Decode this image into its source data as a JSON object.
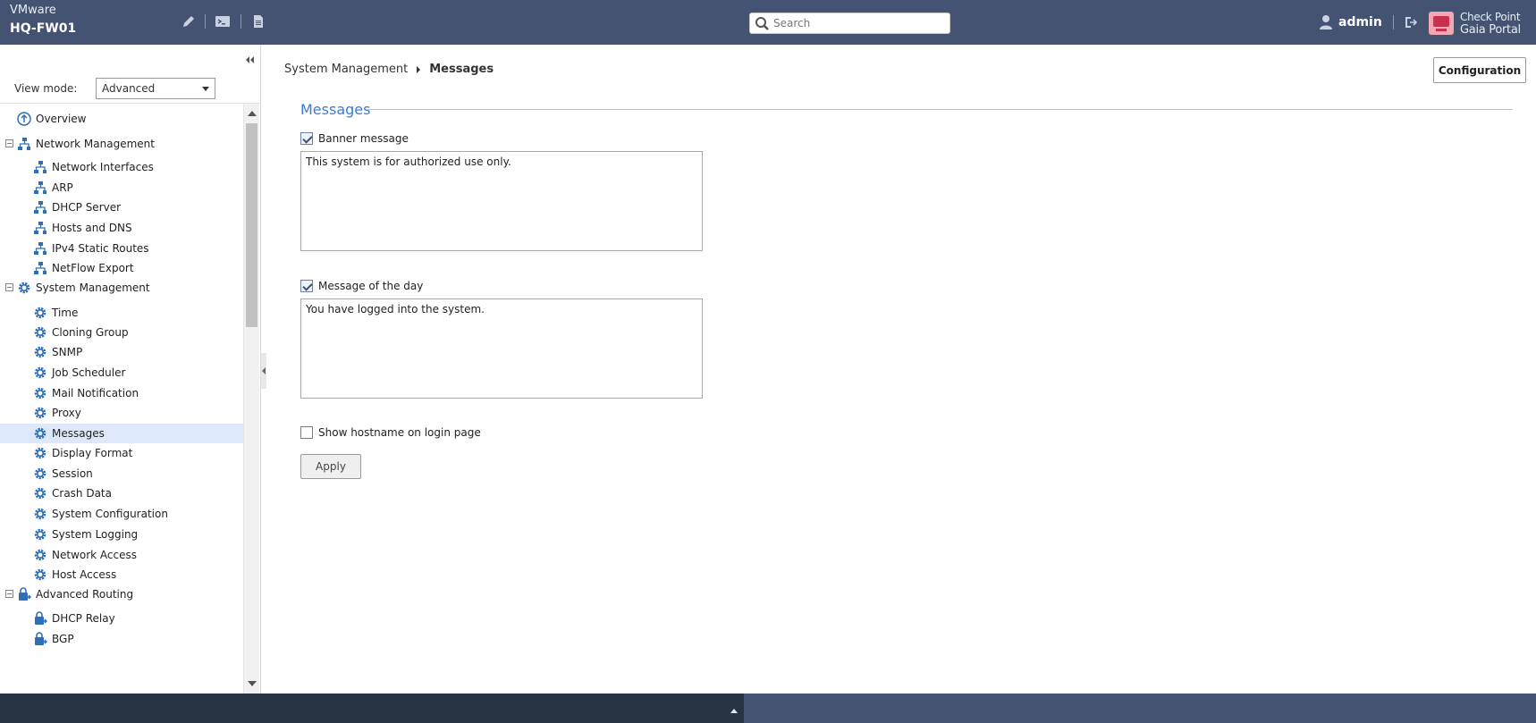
{
  "header": {
    "vendor": "VMware",
    "hostname": "HQ-FW01",
    "search_placeholder": "Search",
    "username": "admin",
    "brand_line1": "Check Point",
    "brand_line2": "Gaia Portal"
  },
  "sidebar": {
    "view_mode_label": "View mode:",
    "view_mode_value": "Advanced",
    "items": [
      {
        "label": "Overview",
        "icon": "overview-icon",
        "level": 0
      },
      {
        "label": "Network Management",
        "icon": "network-icon",
        "level": 0,
        "expanded": true
      },
      {
        "label": "Network Interfaces",
        "icon": "network-icon",
        "level": 1
      },
      {
        "label": "ARP",
        "icon": "network-icon",
        "level": 1
      },
      {
        "label": "DHCP Server",
        "icon": "network-icon",
        "level": 1
      },
      {
        "label": "Hosts and DNS",
        "icon": "network-icon",
        "level": 1
      },
      {
        "label": "IPv4 Static Routes",
        "icon": "network-icon",
        "level": 1
      },
      {
        "label": "NetFlow Export",
        "icon": "network-icon",
        "level": 1
      },
      {
        "label": "System Management",
        "icon": "gear-icon",
        "level": 0,
        "expanded": true
      },
      {
        "label": "Time",
        "icon": "gear-icon",
        "level": 1
      },
      {
        "label": "Cloning Group",
        "icon": "gear-icon",
        "level": 1
      },
      {
        "label": "SNMP",
        "icon": "gear-icon",
        "level": 1
      },
      {
        "label": "Job Scheduler",
        "icon": "gear-icon",
        "level": 1
      },
      {
        "label": "Mail Notification",
        "icon": "gear-icon",
        "level": 1
      },
      {
        "label": "Proxy",
        "icon": "gear-icon",
        "level": 1
      },
      {
        "label": "Messages",
        "icon": "gear-icon",
        "level": 1,
        "selected": true
      },
      {
        "label": "Display Format",
        "icon": "gear-icon",
        "level": 1
      },
      {
        "label": "Session",
        "icon": "gear-icon",
        "level": 1
      },
      {
        "label": "Crash Data",
        "icon": "gear-icon",
        "level": 1
      },
      {
        "label": "System Configuration",
        "icon": "gear-icon",
        "level": 1
      },
      {
        "label": "System Logging",
        "icon": "gear-icon",
        "level": 1
      },
      {
        "label": "Network Access",
        "icon": "gear-icon",
        "level": 1
      },
      {
        "label": "Host Access",
        "icon": "gear-icon",
        "level": 1
      },
      {
        "label": "Advanced Routing",
        "icon": "routing-icon",
        "level": 0,
        "expanded": true
      },
      {
        "label": "DHCP Relay",
        "icon": "routing-icon",
        "level": 1
      },
      {
        "label": "BGP",
        "icon": "routing-icon",
        "level": 1
      }
    ]
  },
  "breadcrumb": {
    "parent": "System Management",
    "current": "Messages"
  },
  "main": {
    "configuration_button": "Configuration",
    "section_title": "Messages",
    "banner_checkbox_label": "Banner message",
    "banner_checked": true,
    "banner_text": "This system is for authorized use only.",
    "motd_checkbox_label": "Message of the day",
    "motd_checked": true,
    "motd_text": "You have logged into the system.",
    "hostname_checkbox_label": "Show hostname on login page",
    "hostname_checked": false,
    "apply_button": "Apply"
  },
  "colors": {
    "header_bg": "#435371",
    "accent_blue": "#3b7bd3",
    "selected_row": "#dde9fb",
    "icon_blue": "#2f6fb8",
    "bottom_dark": "#273444"
  }
}
